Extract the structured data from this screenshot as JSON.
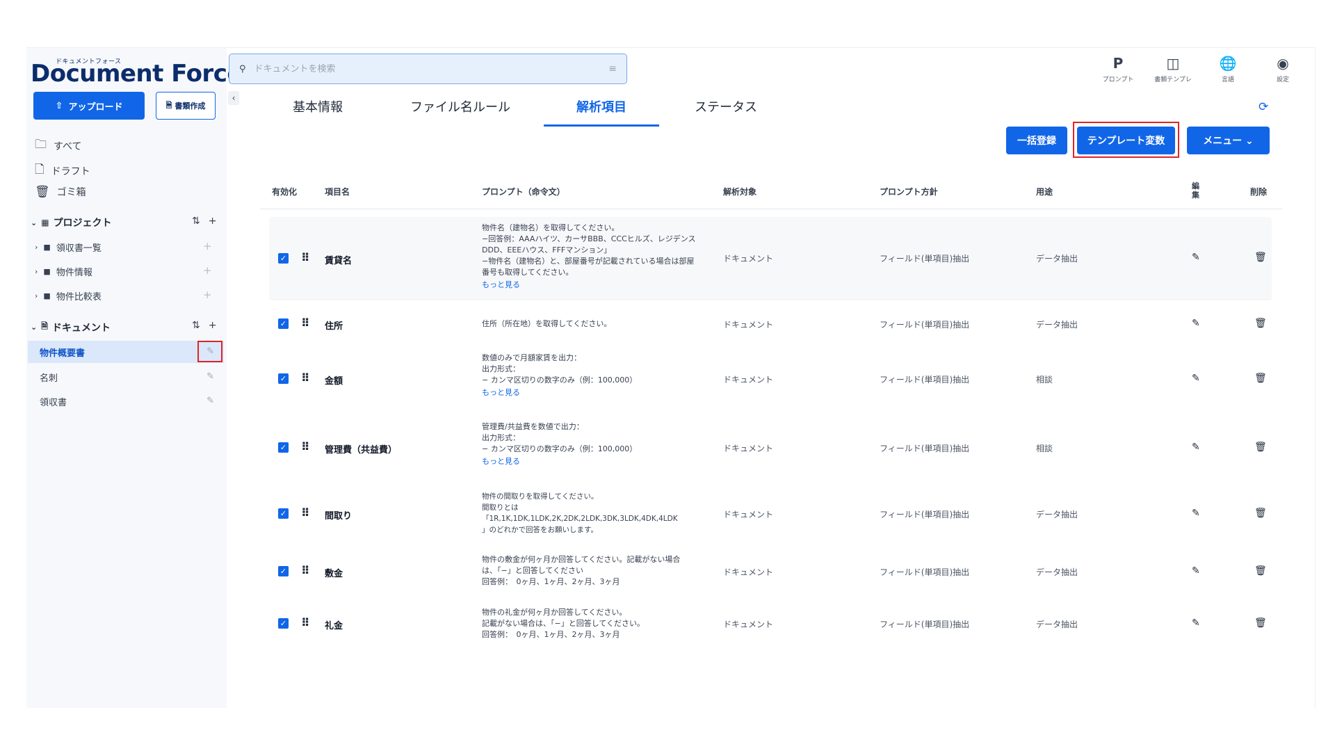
{
  "app": {
    "logo_small": "ドキュメントフォース",
    "logo": "Document Force"
  },
  "sidebar": {
    "upload_label": "アップロード",
    "create_doc_label": "書類作成",
    "nav": [
      {
        "label": "すべて",
        "icon": "folder-icon"
      },
      {
        "label": "ドラフト",
        "icon": "file-icon"
      },
      {
        "label": "ゴミ箱",
        "icon": "trash-icon"
      }
    ],
    "projects_title": "プロジェクト",
    "projects": [
      {
        "label": "領収書一覧"
      },
      {
        "label": "物件情報"
      },
      {
        "label": "物件比較表"
      }
    ],
    "documents_title": "ドキュメント",
    "documents": [
      {
        "label": "物件概要書",
        "active": true
      },
      {
        "label": "名刺",
        "active": false
      },
      {
        "label": "領収書",
        "active": false
      }
    ]
  },
  "search": {
    "placeholder": "ドキュメントを検索"
  },
  "top_icons": [
    {
      "label": "プロンプト",
      "icon": "prompt-icon"
    },
    {
      "label": "書類テンプレ",
      "icon": "template-icon"
    },
    {
      "label": "言語",
      "icon": "globe-icon"
    },
    {
      "label": "設定",
      "icon": "user-settings-icon"
    }
  ],
  "tabs": [
    {
      "label": "基本情報"
    },
    {
      "label": "ファイル名ルール"
    },
    {
      "label": "解析項目",
      "active": true
    },
    {
      "label": "ステータス"
    }
  ],
  "actions": {
    "bulk_register": "一括登録",
    "template_vars": "テンプレート変数",
    "menu": "メニュー ⌄"
  },
  "table": {
    "headers": {
      "enabled": "有効化",
      "item_name": "項目名",
      "prompt": "プロンプト（命令文）",
      "target": "解析対象",
      "policy": "プロンプト方針",
      "usage": "用途",
      "edit": "編\n集",
      "delete": "削除"
    },
    "more_label": "もっと見る",
    "rows": [
      {
        "name": "賃貸名",
        "prompt": "物件名（建物名）を取得してください。\n−回答例：AAAハイツ、カーサBBB、CCCヒルズ、レジデンス\nDDD、EEEハウス、FFFマンション」\n−物件名（建物名）と、部屋番号が記載されている場合は部屋\n番号も取得してください。",
        "more": true,
        "target": "ドキュメント",
        "policy": "フィールド(単項目)抽出",
        "usage": "データ抽出"
      },
      {
        "name": "住所",
        "prompt": "住所（所在地）を取得してください。",
        "more": false,
        "target": "ドキュメント",
        "policy": "フィールド(単項目)抽出",
        "usage": "データ抽出"
      },
      {
        "name": "金額",
        "prompt": "数値のみで月額家賃を出力：\n出力形式：\n− カンマ区切りの数字のみ（例：100,000）",
        "more": true,
        "target": "ドキュメント",
        "policy": "フィールド(単項目)抽出",
        "usage": "相談"
      },
      {
        "name": "管理費（共益費）",
        "prompt": "管理費/共益費を数値で出力：\n出力形式：\n− カンマ区切りの数字のみ（例：100,000）",
        "more": true,
        "target": "ドキュメント",
        "policy": "フィールド(単項目)抽出",
        "usage": "相談"
      },
      {
        "name": "間取り",
        "prompt": "物件の間取りを取得してください。\n間取りとは\n「1R,1K,1DK,1LDK,2K,2DK,2LDK,3DK,3LDK,4DK,4LDK\n」のどれかで回答をお願いします。",
        "more": false,
        "target": "ドキュメント",
        "policy": "フィールド(単項目)抽出",
        "usage": "データ抽出"
      },
      {
        "name": "敷金",
        "prompt": "物件の敷金が何ヶ月か回答してください。記載がない場合\nは、「−」と回答してください\n回答例：　0ヶ月、1ヶ月、2ヶ月、3ヶ月",
        "more": false,
        "target": "ドキュメント",
        "policy": "フィールド(単項目)抽出",
        "usage": "データ抽出"
      },
      {
        "name": "礼金",
        "prompt": "物件の礼金が何ヶ月か回答してください。\n記載がない場合は、「−」と回答してください。\n回答例：　0ヶ月、1ヶ月、2ヶ月、3ヶ月",
        "more": false,
        "target": "ドキュメント",
        "policy": "フィールド(単項目)抽出",
        "usage": "データ抽出"
      }
    ]
  }
}
